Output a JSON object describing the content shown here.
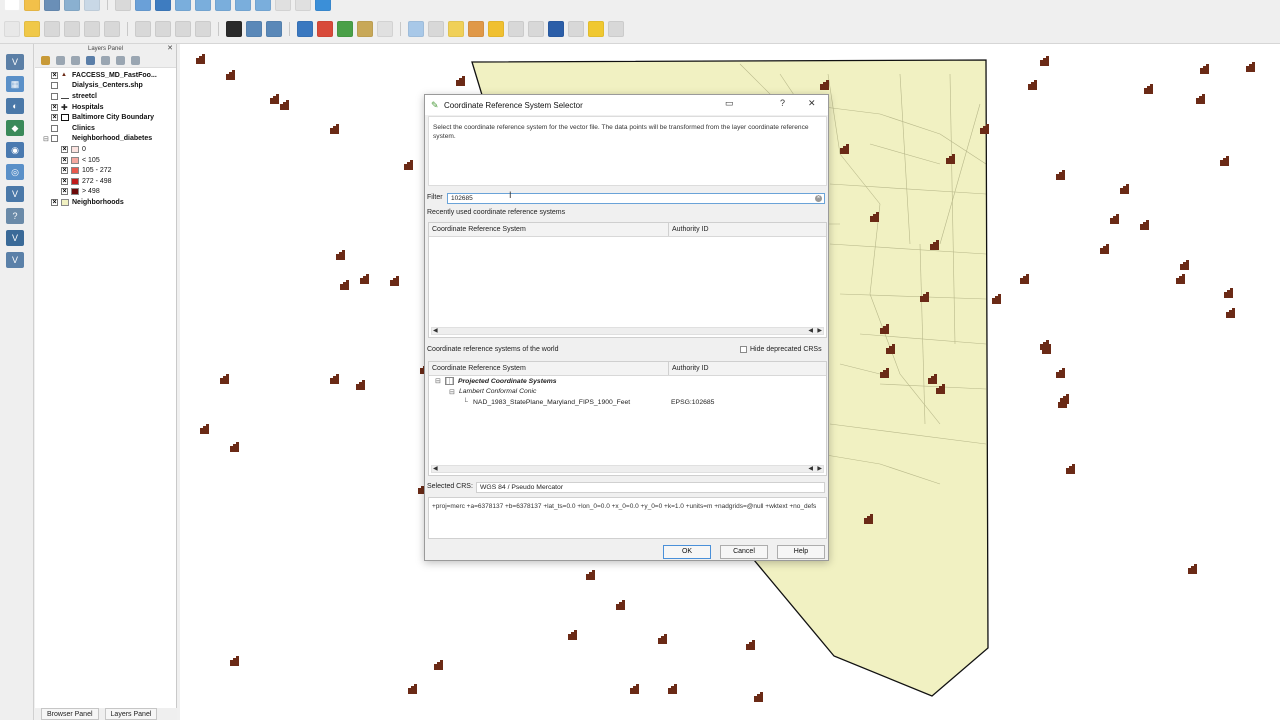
{
  "layers_panel": {
    "title": "Layers Panel",
    "layers": [
      {
        "name": "FACCESS_MD_FastFoo...",
        "checked": true,
        "symbol": "fast-food-point",
        "indent": 0
      },
      {
        "name": "Dialysis_Centers.shp",
        "checked": false,
        "symbol": "point",
        "indent": 0
      },
      {
        "name": "streetcl",
        "checked": false,
        "symbol": "line",
        "indent": 0
      },
      {
        "name": "Hospitals",
        "checked": true,
        "symbol": "cross",
        "indent": 0
      },
      {
        "name": "Baltimore City Boundary",
        "checked": true,
        "symbol": "polygon-outline",
        "indent": 0
      },
      {
        "name": "Clinics",
        "checked": false,
        "symbol": "point",
        "indent": 0
      },
      {
        "name": "Neighborhood_diabetes",
        "checked": false,
        "symbol": "group",
        "indent": 0,
        "expandable": true
      },
      {
        "name": "0",
        "checked": true,
        "symbol": "class-0",
        "indent": 1,
        "plain": true
      },
      {
        "name": "< 105",
        "checked": true,
        "symbol": "class-1",
        "indent": 1,
        "plain": true
      },
      {
        "name": "105 - 272",
        "checked": true,
        "symbol": "class-2",
        "indent": 1,
        "plain": true
      },
      {
        "name": "272 - 498",
        "checked": true,
        "symbol": "class-3",
        "indent": 1,
        "plain": true
      },
      {
        "name": "> 498",
        "checked": true,
        "symbol": "class-4",
        "indent": 1,
        "plain": true
      },
      {
        "name": "Neighborhoods",
        "checked": true,
        "symbol": "polygon-fill",
        "indent": 0
      }
    ],
    "bottom_tabs": [
      "Browser Panel",
      "Layers Panel"
    ]
  },
  "colors": {
    "map_fill": "#f1f1c2",
    "map_stroke": "#b8b88a",
    "boundary": "#111111",
    "marker": "#6b2a16",
    "class-0": "#fbe3e0",
    "class-1": "#f4a8a0",
    "class-2": "#e85a4e",
    "class-3": "#c01b1b",
    "class-4": "#6d0a0a",
    "polygon-fill": "#f1f1c2"
  },
  "dialog": {
    "title": "Coordinate Reference System Selector",
    "description": "Select the coordinate reference system for the vector file. The data points will be transformed from the layer coordinate reference system.",
    "filter_label": "Filter",
    "filter_value": "102685",
    "recent_label": "Recently used coordinate reference systems",
    "col_crs": "Coordinate Reference System",
    "col_authority": "Authority ID",
    "world_label": "Coordinate reference systems of the world",
    "hide_deprecated": "Hide deprecated CRSs",
    "tree": [
      {
        "label": "Projected Coordinate Systems",
        "level": 0,
        "style": "bold-italic"
      },
      {
        "label": "Lambert Conformal Conic",
        "level": 1,
        "style": "italic"
      },
      {
        "label": "NAD_1983_StatePlane_Maryland_FIPS_1900_Feet",
        "level": 2,
        "style": "normal",
        "authority": "EPSG:102685"
      }
    ],
    "selected_label": "Selected CRS:",
    "selected_value": "WGS 84 / Pseudo Mercator",
    "proj_string": "+proj=merc +a=6378137 +b=6378137 +lat_ts=0.0 +lon_0=0.0 +x_0=0.0 +y_0=0 +k=1.0 +units=m +nadgrids=@null +wktext +no_defs",
    "buttons": {
      "ok": "OK",
      "cancel": "Cancel",
      "help": "Help"
    }
  }
}
